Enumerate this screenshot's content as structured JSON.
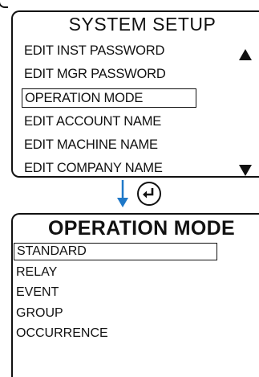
{
  "system_setup": {
    "title": "SYSTEM SETUP",
    "items": [
      {
        "label": "EDIT INST PASSWORD"
      },
      {
        "label": "EDIT MGR PASSWORD"
      },
      {
        "label": "OPERATION MODE",
        "selected": true
      },
      {
        "label": "EDIT ACCOUNT NAME"
      },
      {
        "label": "EDIT MACHINE NAME"
      },
      {
        "label": "EDIT COMPANY NAME"
      }
    ],
    "scroll_up_icon": "triangle-up-icon",
    "scroll_down_icon": "triangle-down-icon"
  },
  "transition": {
    "arrow_icon": "arrow-down-icon",
    "arrow_color": "#1f78c8",
    "enter_icon": "enter-return-icon"
  },
  "operation_mode": {
    "title": "OPERATION MODE",
    "items": [
      {
        "label": "STANDARD",
        "selected": true
      },
      {
        "label": "RELAY"
      },
      {
        "label": "EVENT"
      },
      {
        "label": "GROUP"
      },
      {
        "label": "OCCURRENCE"
      }
    ]
  }
}
